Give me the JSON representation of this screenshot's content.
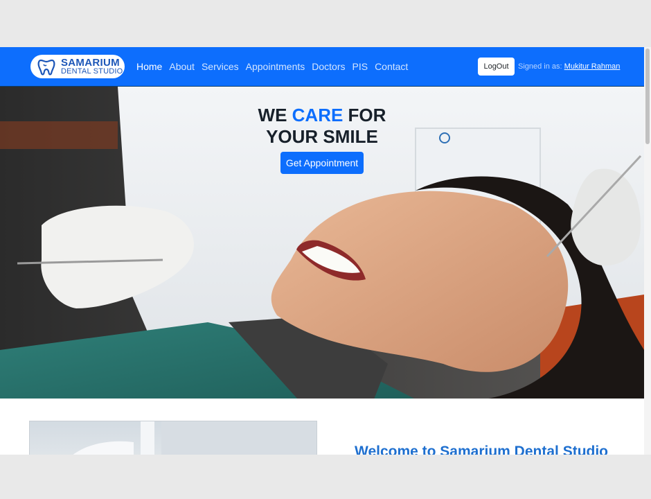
{
  "brand": {
    "line1": "SAMARIUM",
    "line2": "DENTAL STUDIO",
    "icon": "tooth-icon"
  },
  "nav": {
    "items": [
      {
        "label": "Home"
      },
      {
        "label": "About"
      },
      {
        "label": "Services"
      },
      {
        "label": "Appointments"
      },
      {
        "label": "Doctors"
      },
      {
        "label": "PIS"
      },
      {
        "label": "Contact"
      }
    ],
    "logout_label": "LogOut",
    "signed_in_label": "Signed in as:",
    "user_name": "Mukitur Rahman"
  },
  "hero": {
    "title_part1": "WE ",
    "title_accent": "CARE",
    "title_part2": " FOR",
    "title_line2": "YOUR SMILE",
    "button_label": "Get Appointment"
  },
  "welcome": {
    "heading": "Welcome to Samarium Dental Studio"
  },
  "colors": {
    "primary": "#0d6efd",
    "brand_text": "#1c56b8",
    "heading_blue": "#1e6fcf"
  }
}
